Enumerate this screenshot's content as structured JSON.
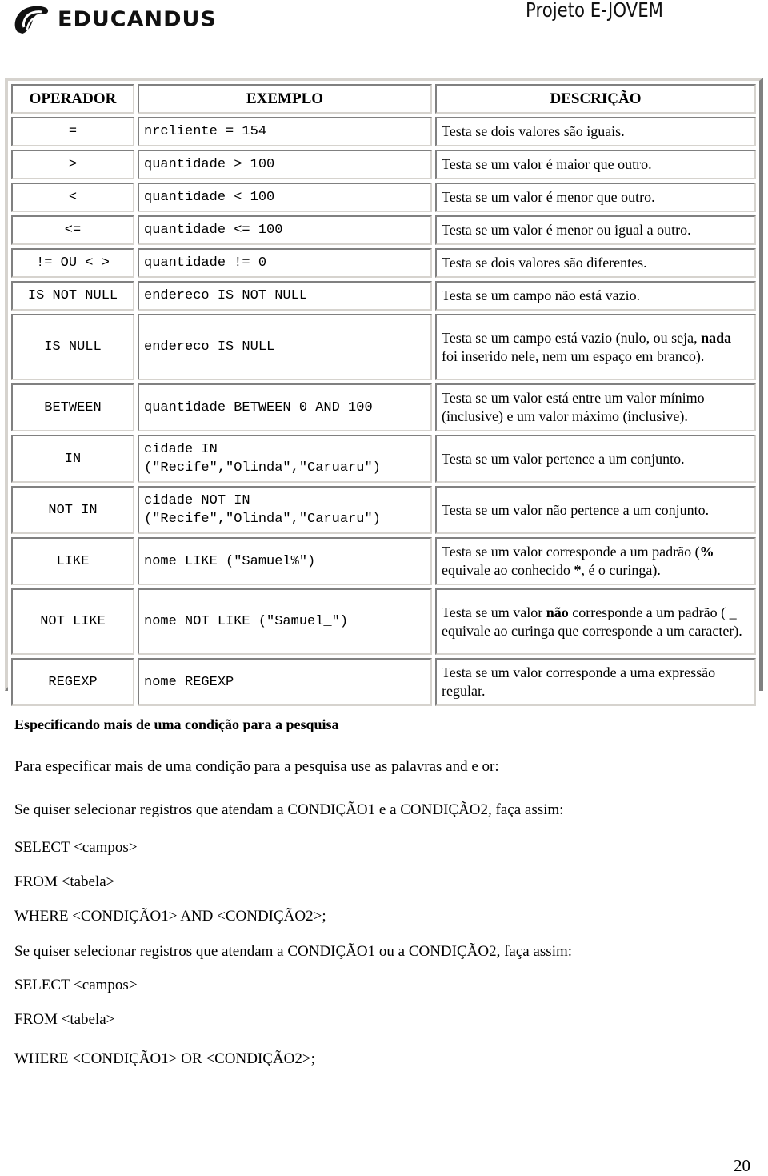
{
  "header": {
    "brand": "EDUCANDUS",
    "brand_icon": "educandus-logo-icon",
    "project_title": "Projeto E-JOVEM"
  },
  "table": {
    "headers": [
      "OPERADOR",
      "EXEMPLO",
      "DESCRIÇÃO"
    ],
    "rows": [
      {
        "operator": "=",
        "example": [
          "nrcliente = 154"
        ],
        "description": [
          {
            "t": "Testa se dois valores são iguais."
          }
        ]
      },
      {
        "operator": ">",
        "example": [
          "quantidade > 100"
        ],
        "description": [
          {
            "t": "Testa se um valor é maior que outro."
          }
        ]
      },
      {
        "operator": "<",
        "example": [
          "quantidade < 100"
        ],
        "description": [
          {
            "t": "Testa se um valor é menor que outro."
          }
        ]
      },
      {
        "operator": "<=",
        "example": [
          "quantidade <= 100"
        ],
        "description": [
          {
            "t": "Testa se um valor é menor ou igual a outro."
          }
        ]
      },
      {
        "operator": "!= OU < >",
        "example": [
          "quantidade != 0"
        ],
        "description": [
          {
            "t": "Testa se dois valores são diferentes."
          }
        ]
      },
      {
        "operator": "IS NOT NULL",
        "example": [
          "endereco IS NOT NULL"
        ],
        "description": [
          {
            "t": "Testa se um campo não está vazio."
          }
        ]
      },
      {
        "operator": "IS NULL",
        "example": [
          "endereco IS NULL"
        ],
        "description": [
          {
            "t": "Testa se um campo está vazio (nulo, ou seja, "
          },
          {
            "t": "nada",
            "b": true
          },
          {
            "t": " foi inserido nele, nem um espaço em branco)."
          }
        ]
      },
      {
        "operator": "BETWEEN",
        "example": [
          "quantidade BETWEEN 0 AND 100"
        ],
        "description": [
          {
            "t": "Testa se um valor está entre um valor mínimo (inclusive) e um valor máximo (inclusive)."
          }
        ]
      },
      {
        "operator": "IN",
        "example": [
          "cidade IN",
          "(\"Recife\",\"Olinda\",\"Caruaru\")"
        ],
        "description": [
          {
            "t": "Testa se um valor pertence a um conjunto."
          }
        ]
      },
      {
        "operator": "NOT IN",
        "example": [
          "cidade NOT IN",
          "(\"Recife\",\"Olinda\",\"Caruaru\")"
        ],
        "description": [
          {
            "t": "Testa se um valor não pertence a um conjunto."
          }
        ]
      },
      {
        "operator": "LIKE",
        "example": [
          "nome LIKE (\"Samuel%\")"
        ],
        "description": [
          {
            "t": "Testa se um valor corresponde a um padrão ("
          },
          {
            "t": "%",
            "b": true
          },
          {
            "t": " equivale ao conhecido "
          },
          {
            "t": "*",
            "b": true
          },
          {
            "t": ", é o curinga)."
          }
        ]
      },
      {
        "operator": "NOT LIKE",
        "example": [
          "nome NOT LIKE (\"Samuel_\")"
        ],
        "description": [
          {
            "t": "Testa se um valor "
          },
          {
            "t": "não",
            "b": true
          },
          {
            "t": " corresponde a um padrão ( _ equivale ao curinga que corresponde a um caracter)."
          }
        ]
      },
      {
        "operator": "REGEXP",
        "example": [
          "nome REGEXP"
        ],
        "description": [
          {
            "t": "Testa se um valor corresponde a uma expressão regular."
          }
        ]
      }
    ]
  },
  "body": {
    "section_title": "Especificando mais de uma condição para a pesquisa",
    "intro": "Para especificar mais de uma condição para a pesquisa use as palavras and e or:",
    "and_intro": "Se quiser selecionar registros que atendam a CONDIÇÃO1 e a CONDIÇÃO2, faça assim:",
    "and_select": "SELECT <campos>",
    "and_from": "FROM <tabela>",
    "and_where": "WHERE <CONDIÇÃO1> AND <CONDIÇÃO2>;",
    "or_intro": "Se quiser selecionar registros que atendam a CONDIÇÃO1 ou a CONDIÇÃO2, faça assim:",
    "or_select": "SELECT <campos>",
    "or_from": "FROM <tabela>",
    "or_where": "WHERE <CONDIÇÃO1> OR <CONDIÇÃO2>;"
  },
  "footer": {
    "page_number": "20"
  }
}
